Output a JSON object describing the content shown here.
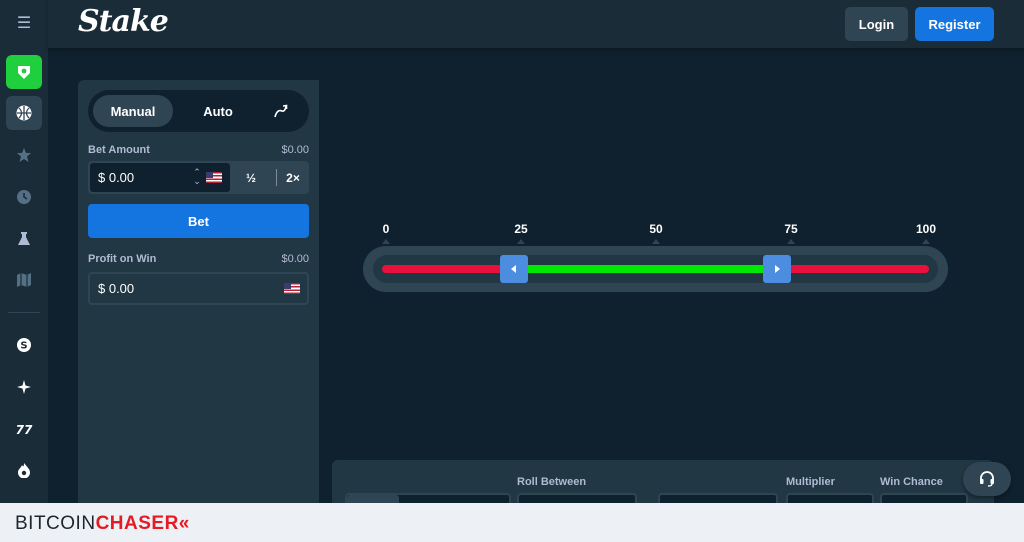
{
  "brand": {
    "logo_text": "Stake"
  },
  "header": {
    "login_label": "Login",
    "register_label": "Register"
  },
  "sidebar": {
    "items": [
      {
        "icon": "menu-icon"
      },
      {
        "icon": "casino-icon"
      },
      {
        "icon": "sports-icon"
      },
      {
        "icon": "star-icon"
      },
      {
        "icon": "clock-icon"
      },
      {
        "icon": "flask-icon"
      },
      {
        "icon": "map-icon"
      },
      {
        "icon": "stake-coin-icon"
      },
      {
        "icon": "sparkle-icon"
      },
      {
        "icon": "sevens-icon"
      },
      {
        "icon": "fire-icon"
      }
    ]
  },
  "controls": {
    "tab_manual": "Manual",
    "tab_auto": "Auto",
    "stats_icon": "chart-arrow-icon",
    "bet_amount_label": "Bet Amount",
    "bet_amount_usd": "$0.00",
    "bet_amount_value": "$ 0.00",
    "half_label": "½",
    "double_label": "2×",
    "bet_button": "Bet",
    "profit_label": "Profit on Win",
    "profit_usd": "$0.00",
    "profit_value": "$ 0.00"
  },
  "slider": {
    "ticks": [
      "0",
      "25",
      "50",
      "75",
      "100"
    ],
    "range_low": 25,
    "range_high": 75,
    "colors": {
      "win": "#00e701",
      "lose": "#e9113c",
      "handle": "#4c8de0"
    }
  },
  "settings": {
    "roll_between_label": "Roll Between",
    "multiplier_label": "Multiplier",
    "win_chance_label": "Win Chance"
  },
  "footer": {
    "brand_part1": "BITCOIN",
    "brand_part2": "CHASER",
    "brand_mark": "«"
  },
  "colors": {
    "bg": "#0f212e",
    "panel": "#213743",
    "accent": "#1475e1",
    "casino_green": "#1fcf3e"
  }
}
